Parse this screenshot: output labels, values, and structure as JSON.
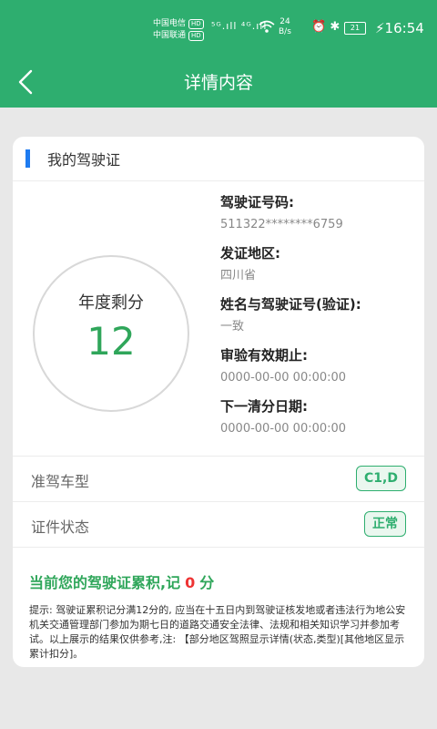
{
  "status_bar": {
    "carrier1": "中国电信",
    "carrier2": "中国联通",
    "hd": "HD",
    "signal": "⁵ᴳ.ıll ⁴ᴳ.ıll",
    "speed_value": "24",
    "speed_unit": "B/s",
    "battery": "21",
    "time": "16:54"
  },
  "nav": {
    "title": "详情内容"
  },
  "card": {
    "section_title": "我的驾驶证",
    "score_label": "年度剩分",
    "score_value": "12",
    "fields": [
      {
        "label": "驾驶证号码:",
        "value": "511322********6759"
      },
      {
        "label": "发证地区:",
        "value": "四川省"
      },
      {
        "label": "姓名与驾驶证号(验证):",
        "value": "一致"
      },
      {
        "label": "审验有效期止:",
        "value": "0000-00-00 00:00:00"
      },
      {
        "label": "下一清分日期:",
        "value": "0000-00-00 00:00:00"
      }
    ],
    "rows": [
      {
        "label": "准驾车型",
        "tag": "C1,D"
      },
      {
        "label": "证件状态",
        "tag": "正常"
      }
    ],
    "summary_prefix": "当前您的驾驶证累积,记",
    "summary_points": "0",
    "summary_suffix": "分",
    "note": "提示: 驾驶证累积记分满12分的, 应当在十五日内到驾驶证核发地或者违法行为地公安机关交通管理部门参加为期七日的道路交通安全法律、法规和相关知识学习并参加考试。以上展示的结果仅供参考,注: 【部分地区驾照显示详情(状态,类型)[其他地区显示累计扣分]。"
  },
  "colors": {
    "header_green": "#2eae6f",
    "score_green": "#2fa65a",
    "accent_blue": "#1e7bf0",
    "points_red": "#e33333"
  }
}
